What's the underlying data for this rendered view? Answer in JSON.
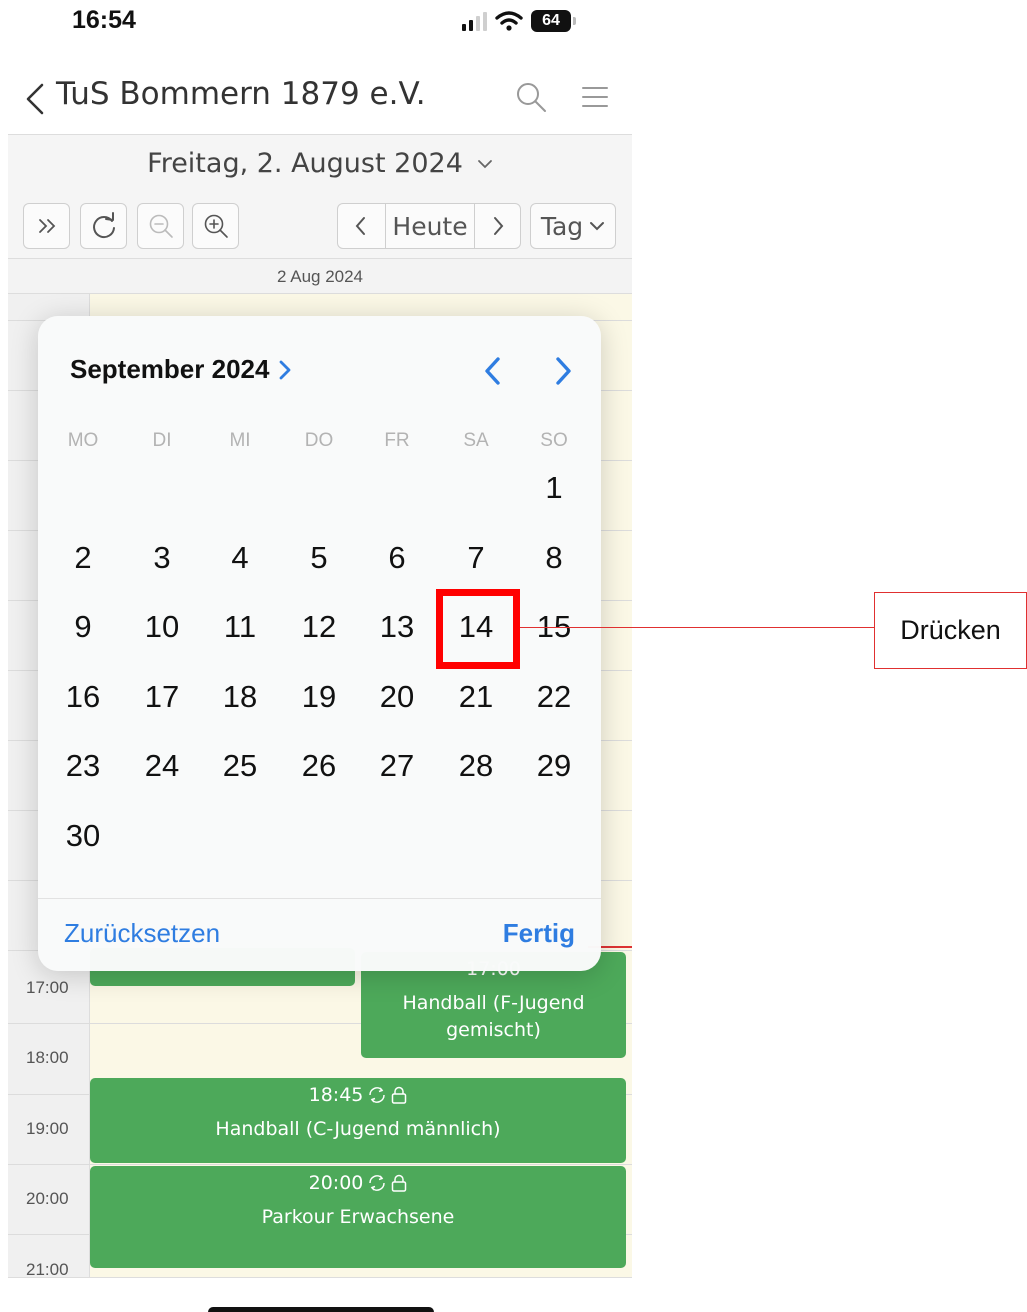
{
  "status_bar": {
    "time": "16:54",
    "battery_level": "64"
  },
  "app": {
    "title": "TuS Bommern 1879 e.V.",
    "day_title": "Freitag, 2. August 2024",
    "toolbar": {
      "today_label": "Heute",
      "view_label": "Tag"
    },
    "calendar": {
      "date_header": "2 Aug 2024",
      "hours": [
        "17:00",
        "18:00",
        "19:00",
        "20:00",
        "21:00"
      ],
      "events": [
        {
          "time": "",
          "title": ""
        },
        {
          "time": "17:00",
          "title": "Handball (F-Jugend gemischt)"
        },
        {
          "time": "18:45",
          "title": "Handball (C-Jugend männlich)"
        },
        {
          "time": "20:00",
          "title": "Parkour Erwachsene"
        }
      ]
    }
  },
  "date_picker": {
    "month_label": "September 2024",
    "weekdays": [
      "MO",
      "DI",
      "MI",
      "DO",
      "FR",
      "SA",
      "SO"
    ],
    "days": [
      "1",
      "2",
      "3",
      "4",
      "5",
      "6",
      "7",
      "8",
      "9",
      "10",
      "11",
      "12",
      "13",
      "14",
      "15",
      "16",
      "17",
      "18",
      "19",
      "20",
      "21",
      "22",
      "23",
      "24",
      "25",
      "26",
      "27",
      "28",
      "29",
      "30"
    ],
    "reset_label": "Zurücksetzen",
    "done_label": "Fertig"
  },
  "annotation": {
    "label": "Drücken",
    "target_day": "14"
  },
  "colors": {
    "accent": "#2f7de1",
    "event_green": "#4da95a",
    "highlight_red": "#ff0000"
  }
}
